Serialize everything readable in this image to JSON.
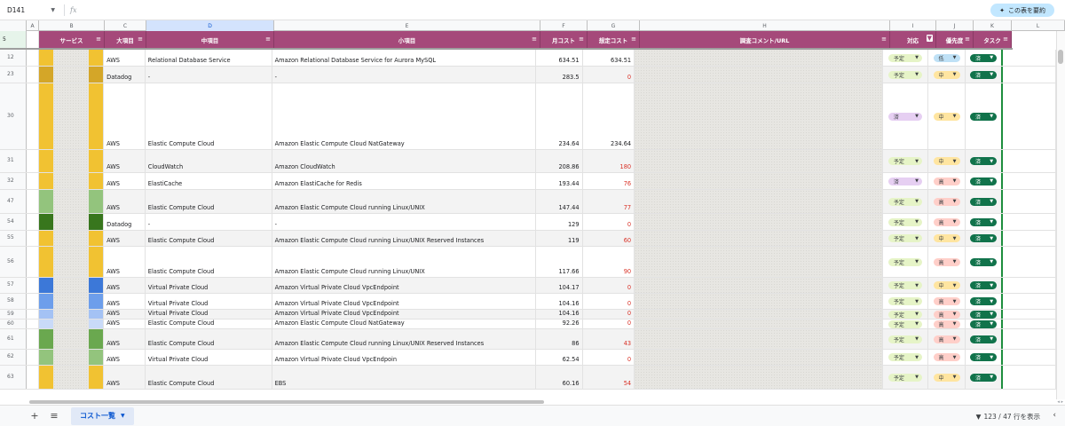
{
  "toolbar": {
    "cell_ref": "D141",
    "fx_label": "fx",
    "summarize_label": "この表を要約",
    "summarize_icon": "sparkle-icon"
  },
  "columns": [
    "A",
    "B",
    "C",
    "D",
    "E",
    "F",
    "G",
    "H",
    "I",
    "J",
    "K",
    "L"
  ],
  "header": {
    "row_number": "5",
    "service": "サービス",
    "category": "大項目",
    "mid_item": "中項目",
    "sub_item": "小項目",
    "monthly_cost": "月コスト",
    "est_cost": "想定コスト",
    "comment": "調査コメント/URL",
    "action": "対応",
    "priority": "優先度",
    "task": "タスク"
  },
  "rows": [
    {
      "num": "12",
      "svc_color": "#f1c232",
      "cat": "AWS",
      "mid": "Relational Database Service",
      "sub": "Amazon Relational Database Service for Aurora MySQL",
      "cost": "634.51",
      "est": "634.51",
      "est_red": false,
      "action": "予定",
      "priority": "低",
      "task": "済"
    },
    {
      "num": "23",
      "svc_color": "#d4a628",
      "cat": "Datadog",
      "mid": "-",
      "sub": "-",
      "cost": "283.5",
      "est": "0",
      "est_red": true,
      "action": "予定",
      "priority": "中",
      "task": "済"
    },
    {
      "num": "30",
      "svc_color": "#f1c232",
      "cat": "AWS",
      "mid": "Elastic Compute Cloud",
      "sub": "Amazon Elastic Compute Cloud NatGateway",
      "cost": "234.64",
      "est": "234.64",
      "est_red": false,
      "action": "済",
      "priority": "中",
      "task": "済"
    },
    {
      "num": "31",
      "svc_color": "#f1c232",
      "cat": "AWS",
      "mid": "CloudWatch",
      "sub": "Amazon CloudWatch",
      "cost": "208.86",
      "est": "180",
      "est_red": true,
      "action": "予定",
      "priority": "中",
      "task": "済"
    },
    {
      "num": "32",
      "svc_color": "#f1c232",
      "cat": "AWS",
      "mid": "ElastiCache",
      "sub": "Amazon ElastiCache for Redis",
      "cost": "193.44",
      "est": "76",
      "est_red": true,
      "action": "済",
      "priority": "高",
      "task": "済"
    },
    {
      "num": "47",
      "svc_color": "#93c47d",
      "cat": "AWS",
      "mid": "Elastic Compute Cloud",
      "sub": "Amazon Elastic Compute Cloud running Linux/UNIX",
      "cost": "147.44",
      "est": "77",
      "est_red": true,
      "action": "予定",
      "priority": "高",
      "task": "済"
    },
    {
      "num": "54",
      "svc_color": "#38761d",
      "cat": "Datadog",
      "mid": "-",
      "sub": "-",
      "cost": "129",
      "est": "0",
      "est_red": true,
      "action": "予定",
      "priority": "高",
      "task": "済"
    },
    {
      "num": "55",
      "svc_color": "#f1c232",
      "cat": "AWS",
      "mid": "Elastic Compute Cloud",
      "sub": "Amazon Elastic Compute Cloud running Linux/UNIX Reserved Instances",
      "cost": "119",
      "est": "60",
      "est_red": true,
      "action": "予定",
      "priority": "中",
      "task": "済"
    },
    {
      "num": "56",
      "svc_color": "#f1c232",
      "cat": "AWS",
      "mid": "Elastic Compute Cloud",
      "sub": "Amazon Elastic Compute Cloud running Linux/UNIX",
      "cost": "117.66",
      "est": "90",
      "est_red": true,
      "action": "予定",
      "priority": "高",
      "task": "済"
    },
    {
      "num": "57",
      "svc_color": "#3c78d8",
      "cat": "AWS",
      "mid": "Virtual Private Cloud",
      "sub": "Amazon Virtual Private Cloud VpcEndpoint",
      "cost": "104.17",
      "est": "0",
      "est_red": true,
      "action": "予定",
      "priority": "中",
      "task": "済"
    },
    {
      "num": "58",
      "svc_color": "#6d9eeb",
      "cat": "AWS",
      "mid": "Virtual Private Cloud",
      "sub": "Amazon Virtual Private Cloud VpcEndpoint",
      "cost": "104.16",
      "est": "0",
      "est_red": true,
      "action": "予定",
      "priority": "高",
      "task": "済"
    },
    {
      "num": "59",
      "svc_color": "#a4c2f4",
      "cat": "AWS",
      "mid": "Virtual Private Cloud",
      "sub": "Amazon Virtual Private Cloud VpcEndpoint",
      "cost": "104.16",
      "est": "0",
      "est_red": true,
      "action": "予定",
      "priority": "高",
      "task": "済"
    },
    {
      "num": "60",
      "svc_color": "#c9daf8",
      "cat": "AWS",
      "mid": "Elastic Compute Cloud",
      "sub": "Amazon Elastic Compute Cloud NatGateway",
      "cost": "92.26",
      "est": "0",
      "est_red": true,
      "action": "予定",
      "priority": "高",
      "task": "済"
    },
    {
      "num": "61",
      "svc_color": "#6aa84f",
      "cat": "AWS",
      "mid": "Elastic Compute Cloud",
      "sub": "Amazon Elastic Compute Cloud running Linux/UNIX Reserved Instances",
      "cost": "86",
      "est": "43",
      "est_red": true,
      "action": "予定",
      "priority": "高",
      "task": "済"
    },
    {
      "num": "62",
      "svc_color": "#93c47d",
      "cat": "AWS",
      "mid": "Virtual Private Cloud",
      "sub": "Amazon Virtual Private Cloud VpcEndpoin",
      "cost": "62.54",
      "est": "0",
      "est_red": true,
      "action": "予定",
      "priority": "高",
      "task": "済"
    },
    {
      "num": "63",
      "svc_color": "#f1c232",
      "cat": "AWS",
      "mid": "Elastic Compute Cloud",
      "sub": "EBS",
      "cost": "60.16",
      "est": "54",
      "est_red": true,
      "action": "予定",
      "priority": "中",
      "task": "済"
    }
  ],
  "sheet_tab": {
    "label": "コスト一覧"
  },
  "status": {
    "row_count": "123 / 47 行を表示"
  },
  "colors": {
    "header_bg": "#a5497a",
    "task_chip": "#11734b",
    "est_red": "#d93025"
  }
}
